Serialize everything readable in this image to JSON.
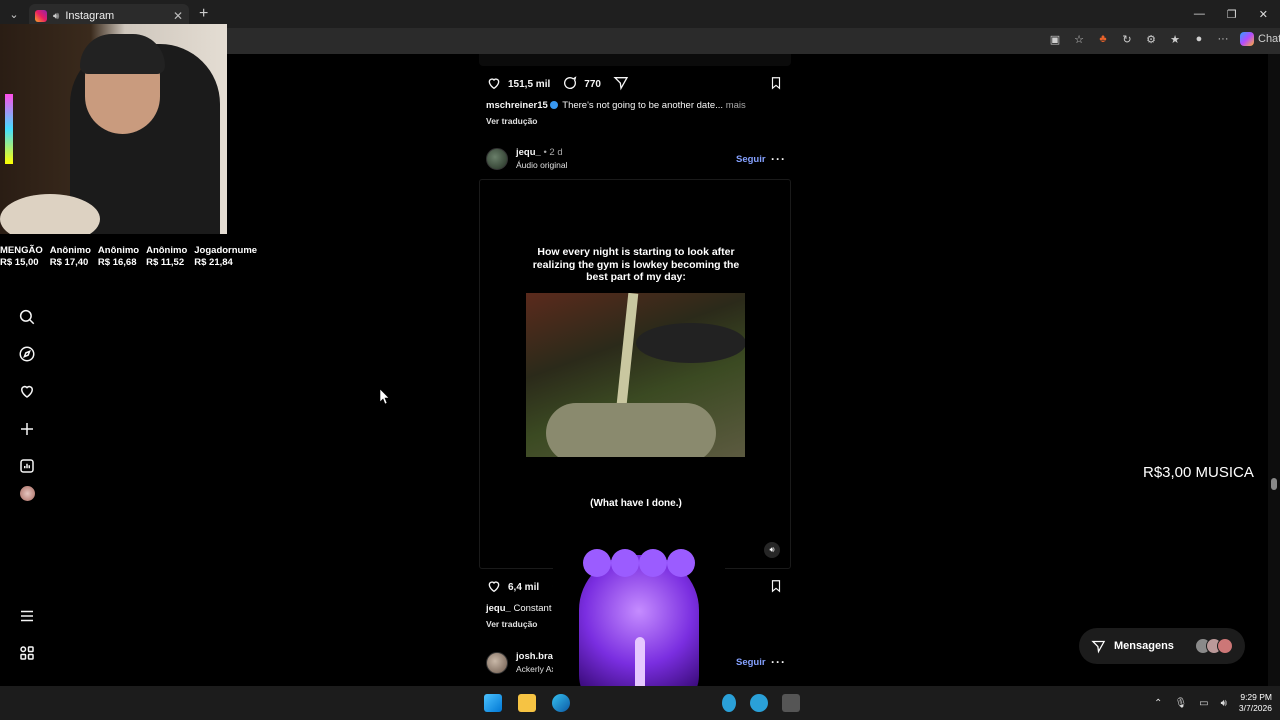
{
  "browser": {
    "tab_title": "Instagram",
    "toolbar_chat_label": "Chat"
  },
  "donations": [
    {
      "name": "MENGÃO",
      "amount": "R$ 15,00"
    },
    {
      "name": "Anônimo",
      "amount": "R$ 17,40"
    },
    {
      "name": "Anônimo",
      "amount": "R$ 16,68"
    },
    {
      "name": "Anônimo",
      "amount": "R$ 11,52"
    },
    {
      "name": "Jogadornume",
      "amount": "R$ 21,84"
    }
  ],
  "post1": {
    "likes": "151,5 mil",
    "comments": "770",
    "username": "mschreiner15",
    "caption": "There's not going to be another date...",
    "more": "mais",
    "translate": "Ver tradução"
  },
  "post2": {
    "username": "jequ_",
    "time": "• 2 d",
    "audio": "Áudio original",
    "follow": "Seguir",
    "media_text": "How every night is starting to look after realizing the gym is lowkey becoming the best part of my day:",
    "media_subtitle": "(What have I done.)",
    "likes": "6,4 mil",
    "caption_user": "jequ_",
    "caption": "Constant s",
    "translate": "Ver tradução"
  },
  "post3": {
    "username": "josh.brak",
    "audio": "Ackerly Ax",
    "follow": "Seguir"
  },
  "side_note": "R$3,00 MUSICA",
  "messages": {
    "label": "Mensagens"
  },
  "clock": {
    "time": "9:29 PM",
    "date": "3/7/2026"
  },
  "icons": {
    "nav": [
      "home-icon",
      "reels-icon",
      "search-icon",
      "explore-icon",
      "heart-icon",
      "create-icon",
      "dashboard-icon",
      "profile-icon",
      "menu-icon",
      "apps-icon"
    ]
  }
}
